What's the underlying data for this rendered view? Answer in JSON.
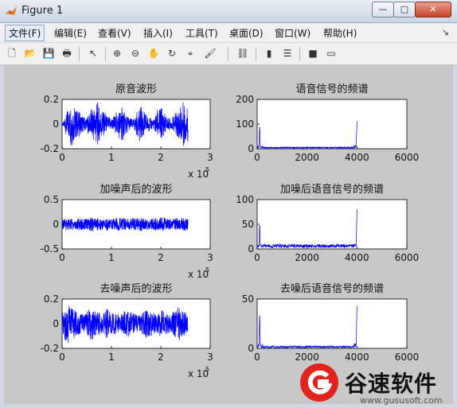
{
  "window": {
    "title": "Figure 1",
    "min_icon": "minimize-icon",
    "max_icon": "maximize-icon",
    "close_icon": "close-icon",
    "min_glyph": "—",
    "max_glyph": "□",
    "close_glyph": "✕"
  },
  "menubar": {
    "items": [
      "文件(F)",
      "编辑(E)",
      "查看(V)",
      "插入(I)",
      "工具(T)",
      "桌面(D)",
      "窗口(W)",
      "帮助(H)"
    ],
    "overflow_glyph": "↘"
  },
  "toolbar": {
    "icons": [
      "new-figure-icon",
      "open-icon",
      "save-icon",
      "print-icon",
      "pointer-icon",
      "zoom-in-icon",
      "zoom-out-icon",
      "pan-icon",
      "rotate-icon",
      "data-cursor-icon",
      "brush-icon",
      "link-plot-icon",
      "colorbar-icon",
      "legend-icon",
      "hide-tools-icon",
      "show-tools-icon"
    ],
    "glyphs": [
      "🗋",
      "📂",
      "💾",
      "🖶",
      "↖",
      "⊕",
      "⊖",
      "✋",
      "↻",
      "⌖",
      "🖌",
      "⛓",
      "▮",
      "☰",
      "■",
      "▭"
    ]
  },
  "colors": {
    "line": "#0000ff",
    "axes_bg": "#ffffff",
    "figure_bg": "#c8c8c8",
    "accent": "#e2221c"
  },
  "watermark": {
    "text": "谷速软件",
    "url": "www.gususoft.com"
  },
  "chart_data": [
    {
      "type": "line",
      "title": "原音波形",
      "xlim": [
        0,
        300000
      ],
      "ylim": [
        -0.2,
        0.2
      ],
      "xticks": [
        "0",
        "1",
        "2",
        "3"
      ],
      "yticks": [
        "0.2",
        "0",
        "-0.2"
      ],
      "x_exponent": "x 10",
      "x_exponent_power": "5",
      "series": [
        {
          "x_end": 255000,
          "envelope": [
            0.02,
            0.08,
            0.12,
            0.18,
            0.15,
            0.12,
            0.1,
            0.08,
            0.06,
            0.05,
            0.08,
            0.12,
            0.15,
            0.18,
            0.14,
            0.12,
            0.1,
            0.07,
            0.06,
            0.05,
            0.07,
            0.1,
            0.12,
            0.14,
            0.1,
            0.07,
            0.05,
            0.04,
            0.06,
            0.1,
            0.14,
            0.12,
            0.09,
            0.06,
            0.05,
            0.04,
            0.08,
            0.12,
            0.14,
            0.1,
            0.07,
            0.05,
            0.04,
            0.06,
            0.1,
            0.12,
            0.15,
            0.18,
            0.15,
            0.1
          ]
        }
      ]
    },
    {
      "type": "line",
      "title": "语音信号的频谱",
      "xlim": [
        0,
        6000
      ],
      "ylim": [
        0,
        200
      ],
      "xticks": [
        "0",
        "2000",
        "4000",
        "6000"
      ],
      "yticks": [
        "200",
        "100",
        "0"
      ],
      "series": [
        {
          "x_end": 4000,
          "peaks": [
            [
              100,
              100
            ],
            [
              4000,
              112
            ]
          ],
          "floor": 6
        }
      ]
    },
    {
      "type": "line",
      "title": "加噪声后的波形",
      "xlim": [
        0,
        300000
      ],
      "ylim": [
        -0.5,
        0.5
      ],
      "xticks": [
        "0",
        "1",
        "2",
        "3"
      ],
      "yticks": [
        "0.5",
        "0",
        "-0.5"
      ],
      "x_exponent": "x 10",
      "x_exponent_power": "5",
      "series": [
        {
          "x_end": 255000,
          "envelope": [
            0.1,
            0.12,
            0.13,
            0.12,
            0.14,
            0.13,
            0.12,
            0.13,
            0.12,
            0.11,
            0.13,
            0.14,
            0.13,
            0.12,
            0.13,
            0.12,
            0.11,
            0.13,
            0.12,
            0.12,
            0.13,
            0.14,
            0.13,
            0.12,
            0.12,
            0.11,
            0.12,
            0.13,
            0.12,
            0.13,
            0.14,
            0.13,
            0.12,
            0.12,
            0.11,
            0.12,
            0.13,
            0.12,
            0.14,
            0.13,
            0.12,
            0.12,
            0.11,
            0.12,
            0.13,
            0.12,
            0.13,
            0.14,
            0.13,
            0.12
          ]
        }
      ]
    },
    {
      "type": "line",
      "title": "加噪后语音信号的频谱",
      "xlim": [
        0,
        6000
      ],
      "ylim": [
        0,
        100
      ],
      "xticks": [
        "0",
        "2000",
        "4000",
        "6000"
      ],
      "yticks": [
        "100",
        "50",
        "0"
      ],
      "series": [
        {
          "x_end": 4000,
          "peaks": [
            [
              100,
              55
            ],
            [
              4000,
              80
            ]
          ],
          "floor": 8
        }
      ]
    },
    {
      "type": "line",
      "title": "去噪声后的波形",
      "xlim": [
        0,
        300000
      ],
      "ylim": [
        -0.2,
        0.2
      ],
      "xticks": [
        "0",
        "1",
        "2",
        "3"
      ],
      "yticks": [
        "0.2",
        "0",
        "-0.2"
      ],
      "x_exponent": "x 10",
      "x_exponent_power": "5",
      "series": [
        {
          "x_end": 255000,
          "envelope": [
            0.1,
            0.14,
            0.16,
            0.13,
            0.12,
            0.1,
            0.09,
            0.08,
            0.09,
            0.1,
            0.12,
            0.13,
            0.11,
            0.1,
            0.09,
            0.08,
            0.1,
            0.12,
            0.11,
            0.1,
            0.09,
            0.08,
            0.07,
            0.08,
            0.1,
            0.11,
            0.1,
            0.09,
            0.08,
            0.07,
            0.08,
            0.1,
            0.12,
            0.11,
            0.1,
            0.09,
            0.08,
            0.09,
            0.11,
            0.12,
            0.1,
            0.09,
            0.08,
            0.1,
            0.12,
            0.14,
            0.12,
            0.1,
            0.09,
            0.08
          ]
        }
      ]
    },
    {
      "type": "line",
      "title": "去噪后语音信号的频谱",
      "xlim": [
        0,
        6000
      ],
      "ylim": [
        0,
        50
      ],
      "xticks": [
        "0",
        "2000",
        "4000",
        "6000"
      ],
      "yticks": [
        "50",
        "0"
      ],
      "series": [
        {
          "x_end": 4000,
          "peaks": [
            [
              100,
              38
            ],
            [
              4000,
              43
            ]
          ],
          "floor": 2
        }
      ]
    }
  ]
}
